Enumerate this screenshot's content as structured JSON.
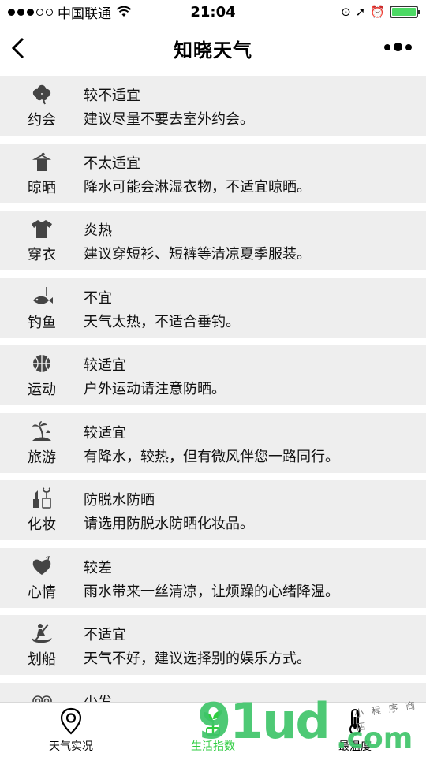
{
  "status_bar": {
    "carrier": "中国联通",
    "time": "21:04",
    "signal_bars_filled": 3,
    "signal_bars_total": 5,
    "battery_level": 1.0,
    "battery_color": "#4cd964"
  },
  "nav": {
    "title": "知晓天气",
    "back_icon": "chevron-left-icon",
    "more_icon": "more-dots-icon"
  },
  "indices": [
    {
      "icon": "clover-icon",
      "name": "约会",
      "brief": "较不适宜",
      "detail": "建议尽量不要去室外约会。"
    },
    {
      "icon": "hanger-shirt-icon",
      "name": "晾晒",
      "brief": "不太适宜",
      "detail": "降水可能会淋湿衣物，不适宜晾晒。"
    },
    {
      "icon": "tshirt-icon",
      "name": "穿衣",
      "brief": "炎热",
      "detail": "建议穿短衫、短裤等清凉夏季服装。"
    },
    {
      "icon": "fish-hook-icon",
      "name": "钓鱼",
      "brief": "不宜",
      "detail": "天气太热，不适合垂钓。"
    },
    {
      "icon": "basketball-icon",
      "name": "运动",
      "brief": "较适宜",
      "detail": "户外运动请注意防晒。"
    },
    {
      "icon": "island-palm-icon",
      "name": "旅游",
      "brief": "较适宜",
      "detail": "有降水，较热，但有微风伴您一路同行。"
    },
    {
      "icon": "cosmetics-icon",
      "name": "化妆",
      "brief": "防脱水防晒",
      "detail": "请选用防脱水防晒化妆品。"
    },
    {
      "icon": "heart-icon",
      "name": "心情",
      "brief": "较差",
      "detail": "雨水带来一丝清凉，让烦躁的心绪降温。"
    },
    {
      "icon": "rowing-icon",
      "name": "划船",
      "brief": "不适宜",
      "detail": "天气不好，建议选择别的娱乐方式。"
    },
    {
      "icon": "swirl-icon",
      "name": "",
      "brief": "少发",
      "detail": ""
    }
  ],
  "tabs": [
    {
      "icon": "location-pin-icon",
      "label": "天气实况",
      "active": false
    },
    {
      "icon": "sprout-icon",
      "label": "生活指数",
      "active": true
    },
    {
      "icon": "thermometer-icon",
      "label": "最温度",
      "active": false
    }
  ],
  "watermark": {
    "big": "91ud",
    "com": ".com",
    "small": "小 程 序 商 店"
  },
  "colors": {
    "row_background": "#eeeeee",
    "active_tab": "#2ecc40",
    "watermark_green": "#3fc56a"
  }
}
